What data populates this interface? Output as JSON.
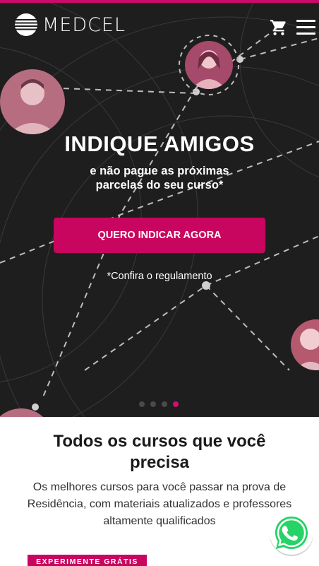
{
  "header": {
    "brand": "MEDCEL",
    "cart_icon": "shopping-cart-icon",
    "menu_icon": "hamburger-menu-icon"
  },
  "hero": {
    "title": "INDIQUE AMIGOS",
    "subtitle": "e não pague as próximas parcelas do seu curso*",
    "cta_label": "QUERO INDICAR AGORA",
    "note": "*Confira o regulamento",
    "carousel": {
      "slides": 4,
      "active": 4
    }
  },
  "courses": {
    "title": "Todos os cursos que você precisa",
    "description": "Os melhores cursos para você passar na prova de Residência, com materiais atualizados e professores altamente qualificados",
    "badge": "EXPERIMENTE GRÁTIS"
  },
  "colors": {
    "accent": "#c8065f",
    "hero_bg": "#1f1e1f",
    "whatsapp": "#25d366"
  },
  "floating": {
    "whatsapp_icon": "whatsapp-icon"
  }
}
